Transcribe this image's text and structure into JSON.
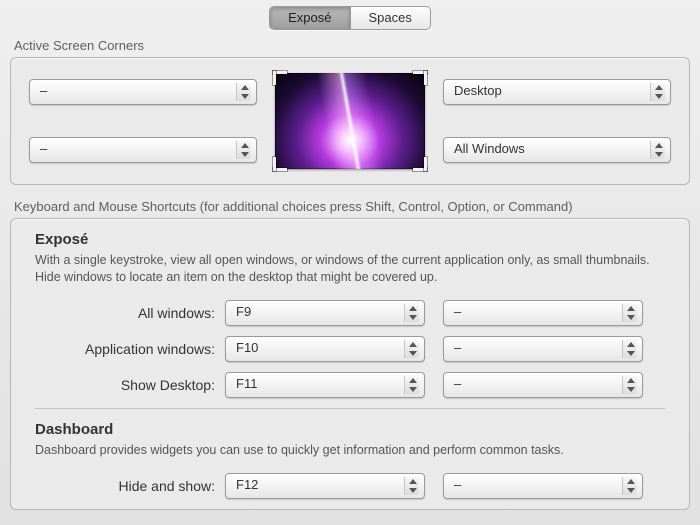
{
  "tabs": {
    "expose": "Exposé",
    "spaces": "Spaces",
    "active": "expose"
  },
  "corners": {
    "section_label": "Active Screen Corners",
    "top_left": "–",
    "top_right": "Desktop",
    "bottom_left": "–",
    "bottom_right": "All Windows"
  },
  "shortcuts": {
    "section_label": "Keyboard and Mouse Shortcuts (for additional choices press Shift, Control, Option, or Command)",
    "expose": {
      "title": "Exposé",
      "desc": "With a single keystroke, view all open windows, or windows of the current application only, as small thumbnails. Hide windows to locate an item on the desktop that might be covered up.",
      "rows": [
        {
          "label": "All windows:",
          "key": "F9",
          "mouse": "–"
        },
        {
          "label": "Application windows:",
          "key": "F10",
          "mouse": "–"
        },
        {
          "label": "Show Desktop:",
          "key": "F11",
          "mouse": "–"
        }
      ]
    },
    "dashboard": {
      "title": "Dashboard",
      "desc": "Dashboard provides widgets you can use to quickly get information and perform common tasks.",
      "row": {
        "label": "Hide and show:",
        "key": "F12",
        "mouse": "–"
      }
    }
  }
}
